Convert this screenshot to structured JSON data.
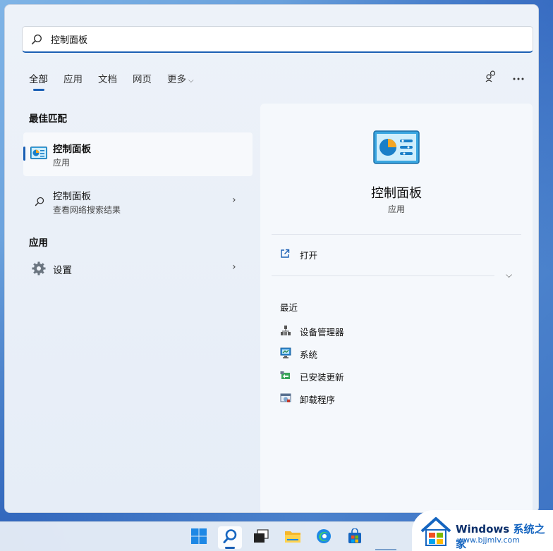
{
  "search": {
    "value": "控制面板"
  },
  "tabs": [
    {
      "label": "全部",
      "active": true
    },
    {
      "label": "应用"
    },
    {
      "label": "文档"
    },
    {
      "label": "网页"
    },
    {
      "label": "更多"
    }
  ],
  "left": {
    "best_match_title": "最佳匹配",
    "best_match": {
      "title": "控制面板",
      "subtitle": "应用"
    },
    "web_result": {
      "title": "控制面板",
      "subtitle": "查看网络搜索结果"
    },
    "apps_title": "应用",
    "apps": [
      {
        "title": "设置"
      }
    ]
  },
  "detail": {
    "title": "控制面板",
    "subtitle": "应用",
    "open_label": "打开",
    "recent_title": "最近",
    "recent": [
      {
        "label": "设备管理器",
        "icon": "device-manager-icon"
      },
      {
        "label": "系统",
        "icon": "system-icon"
      },
      {
        "label": "已安装更新",
        "icon": "installed-updates-icon"
      },
      {
        "label": "卸载程序",
        "icon": "uninstall-program-icon"
      }
    ]
  },
  "watermark": {
    "brand": "Windows",
    "brand_cn": "系统之家",
    "url": "www.bjjmlv.com"
  },
  "colors": {
    "accent": "#1a5fb4",
    "panel_bg": "#edf2f9",
    "detail_bg": "#f5f8fc"
  }
}
